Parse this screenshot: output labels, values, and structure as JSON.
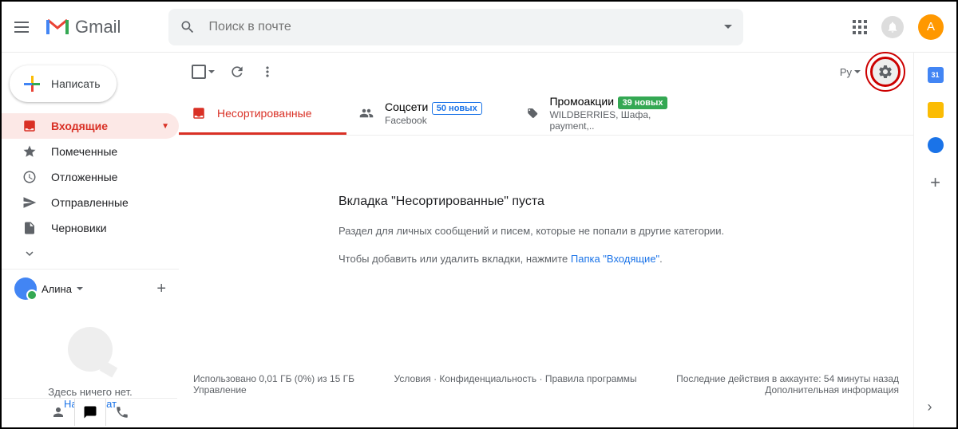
{
  "header": {
    "brand": "Gmail",
    "search_placeholder": "Поиск в почте",
    "avatar_initial": "А"
  },
  "compose_label": "Написать",
  "sidebar": {
    "items": [
      {
        "label": "Входящие"
      },
      {
        "label": "Помеченные"
      },
      {
        "label": "Отложенные"
      },
      {
        "label": "Отправленные"
      },
      {
        "label": "Черновики"
      }
    ]
  },
  "hangouts": {
    "user": "Алина",
    "empty_text": "Здесь ничего нет.",
    "start_chat": "Начать чат"
  },
  "toolbar": {
    "lang": "Ру"
  },
  "tabs": {
    "primary": {
      "label": "Несортированные"
    },
    "social": {
      "label": "Соцсети",
      "badge": "50 новых",
      "sub": "Facebook"
    },
    "promo": {
      "label": "Промоакции",
      "badge": "39 новых",
      "sub": "WILDBERRIES, Шафа, payment,.."
    }
  },
  "empty": {
    "title": "Вкладка \"Несортированные\" пуста",
    "line1": "Раздел для личных сообщений и писем, которые не попали в другие категории.",
    "line2a": "Чтобы добавить или удалить вкладки, нажмите ",
    "line2b": "Папка \"Входящие\"",
    "line2c": "."
  },
  "footer": {
    "storage1": "Использовано 0,01 ГБ (0%) из 15 ГБ",
    "storage2": "Управление",
    "terms": "Условия",
    "privacy": "Конфиденциальность",
    "policies": "Правила программы",
    "activity1": "Последние действия в аккаунте: 54 минуты назад",
    "activity2": "Дополнительная информация"
  },
  "rail": {
    "cal_day": "31"
  }
}
